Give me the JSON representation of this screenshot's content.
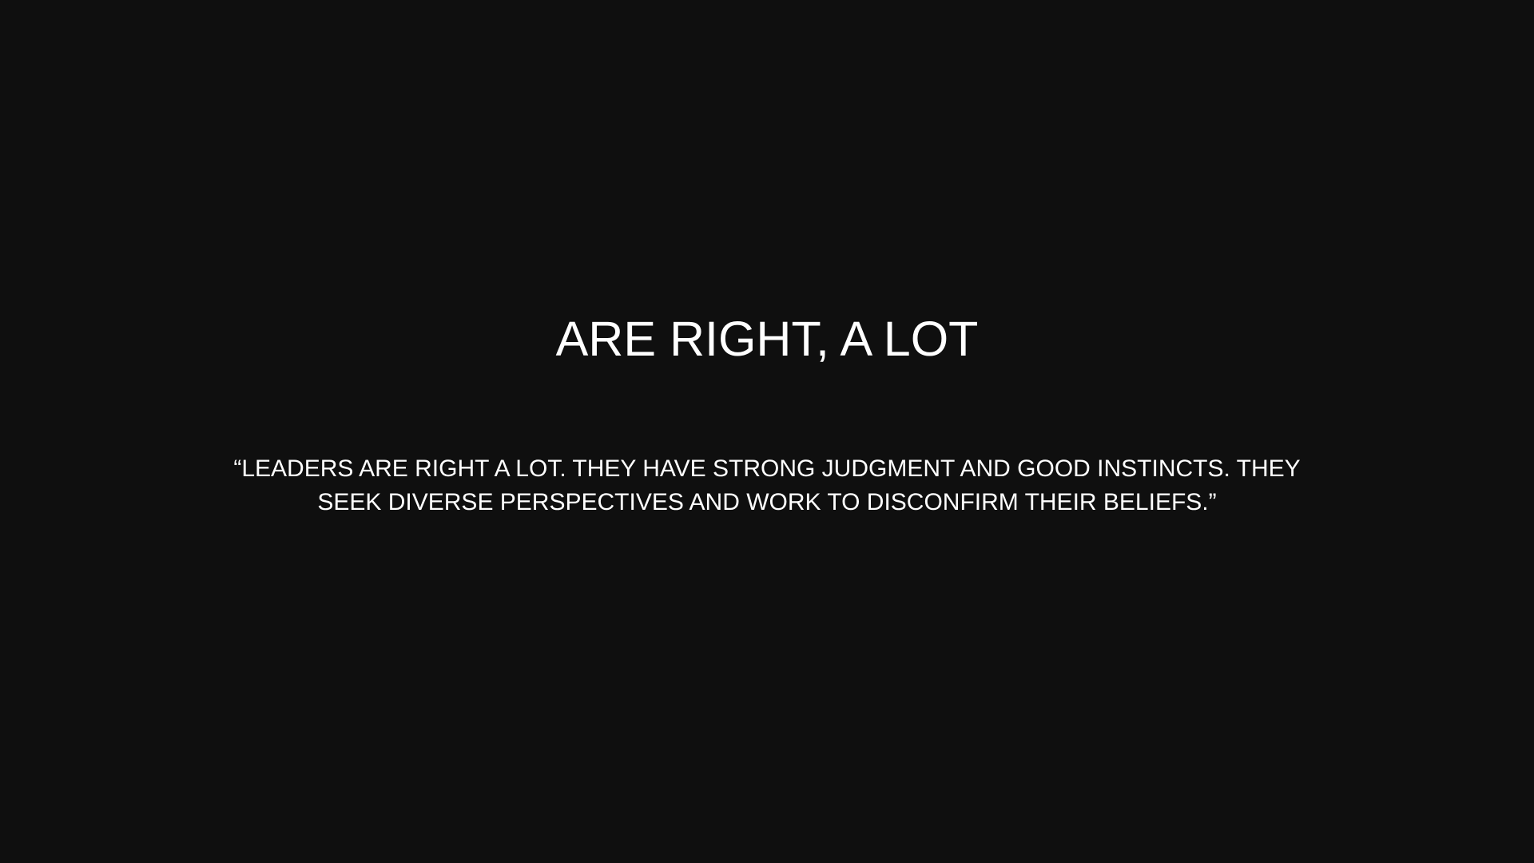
{
  "slide": {
    "title": "ARE RIGHT, A LOT",
    "quote": "“LEADERS ARE RIGHT A LOT. THEY HAVE STRONG JUDGMENT AND GOOD INSTINCTS. THEY SEEK DIVERSE PERSPECTIVES AND WORK TO DISCONFIRM THEIR BELIEFS.”"
  },
  "colors": {
    "background": "#0f0f0f",
    "text": "#ffffff"
  }
}
